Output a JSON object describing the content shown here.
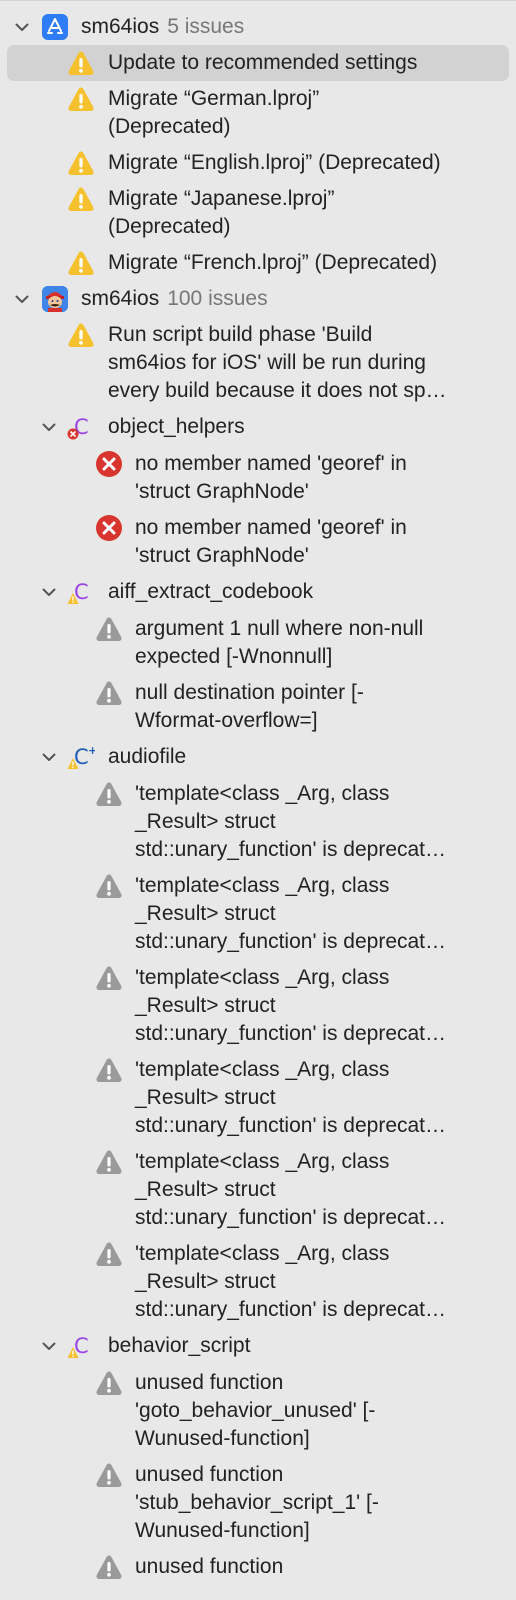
{
  "groups": [
    {
      "project": "sm64ios",
      "count": "5 issues",
      "icon": "app-store-icon",
      "items": [
        {
          "lines": [
            "Update to recommended settings"
          ],
          "selected": true
        },
        {
          "lines": [
            "Migrate “German.lproj”",
            "(Deprecated)"
          ]
        },
        {
          "lines": [
            "Migrate “English.lproj” (Deprecated)"
          ]
        },
        {
          "lines": [
            "Migrate “Japanese.lproj”",
            "(Deprecated)"
          ]
        },
        {
          "lines": [
            "Migrate “French.lproj” (Deprecated)"
          ]
        }
      ]
    },
    {
      "project": "sm64ios",
      "count": "100 issues",
      "icon": "mario-app-icon",
      "warning": [
        "Run script build phase 'Build",
        "sm64ios for iOS' will be run during",
        "every build because it does not sp…"
      ],
      "files": [
        {
          "name": "object_helpers",
          "icon": "c-file-error-icon",
          "items": [
            [
              "no member named 'georef' in",
              "'struct GraphNode'"
            ],
            [
              "no member named 'georef' in",
              "'struct GraphNode'"
            ]
          ]
        },
        {
          "name": "aiff_extract_codebook",
          "icon": "c-file-warning-icon",
          "items": [
            [
              "argument 1 null where non-null",
              "expected [-Wnonnull]"
            ],
            [
              "null destination pointer [-",
              "Wformat-overflow=]"
            ]
          ]
        },
        {
          "name": "audiofile",
          "icon": "cpp-file-warning-icon",
          "items": [
            [
              "'template<class _Arg, class",
              "_Result> struct",
              "std::unary_function' is deprecat…"
            ],
            [
              "'template<class _Arg, class",
              "_Result> struct",
              "std::unary_function' is deprecat…"
            ],
            [
              "'template<class _Arg, class",
              "_Result> struct",
              "std::unary_function' is deprecat…"
            ],
            [
              "'template<class _Arg, class",
              "_Result> struct",
              "std::unary_function' is deprecat…"
            ],
            [
              "'template<class _Arg, class",
              "_Result> struct",
              "std::unary_function' is deprecat…"
            ],
            [
              "'template<class _Arg, class",
              "_Result> struct",
              "std::unary_function' is deprecat…"
            ]
          ]
        },
        {
          "name": "behavior_script",
          "icon": "c-file-warning-icon",
          "items": [
            [
              "unused function",
              "'goto_behavior_unused' [-",
              "Wunused-function]"
            ],
            [
              "unused function",
              "'stub_behavior_script_1' [-",
              "Wunused-function]"
            ],
            [
              "unused function"
            ]
          ]
        }
      ]
    }
  ],
  "colors": {
    "warning_yellow": "#f5c12e",
    "error_red": "#d8352f",
    "grey_warning": "#9a9a9a",
    "c_purple": "#9b45e6",
    "app_blue": "#2e7cf6"
  }
}
